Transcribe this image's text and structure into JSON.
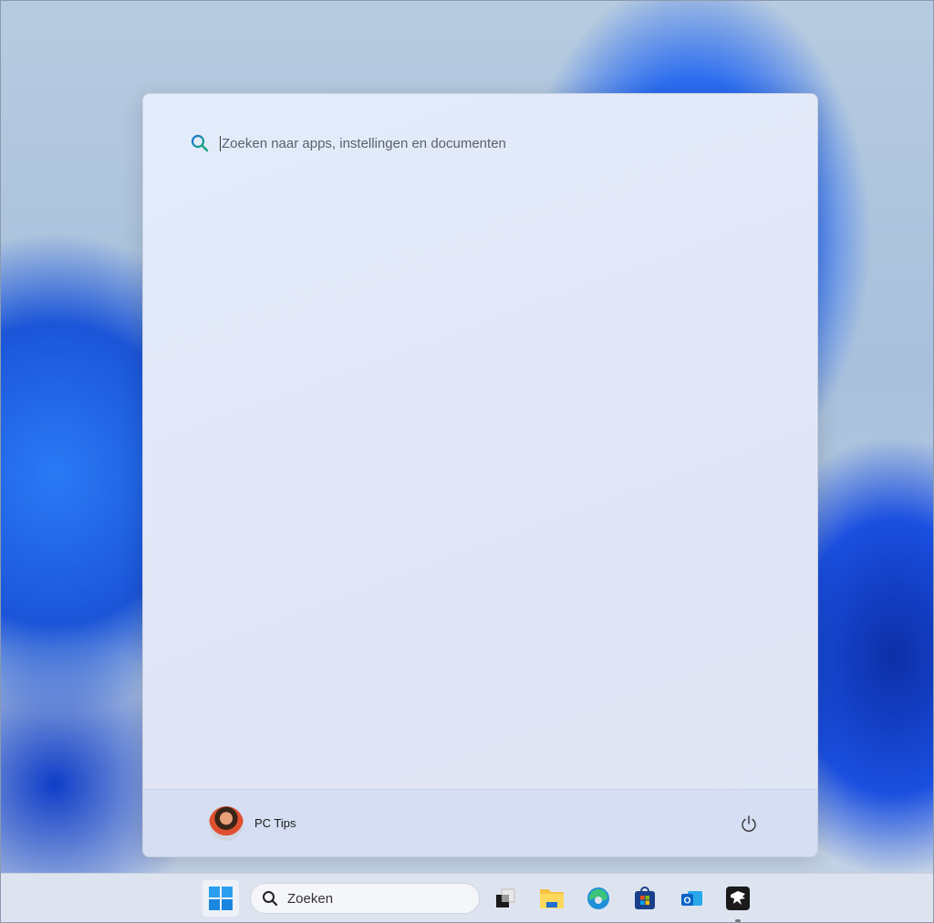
{
  "start_menu": {
    "search_placeholder": "Zoeken naar apps, instellingen en documenten",
    "user_name": "PC Tips"
  },
  "taskbar": {
    "search_label": "Zoeken",
    "apps": [
      "start-icon",
      "task-view-icon",
      "file-explorer-icon",
      "edge-icon",
      "store-icon",
      "outlook-icon",
      "eagle-app-icon"
    ]
  }
}
